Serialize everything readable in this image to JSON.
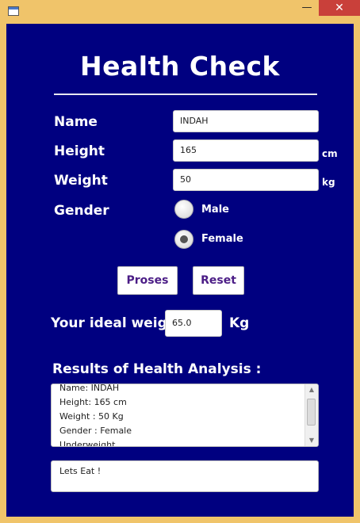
{
  "window": {
    "minimize_glyph": "—",
    "maximize_glyph": "☐",
    "close_glyph": "✕",
    "icon": "app-window-icon"
  },
  "form": {
    "title": "Health Check",
    "name_label": "Name",
    "name_value": "INDAH",
    "height_label": "Height",
    "height_value": "165",
    "height_unit": "cm",
    "weight_label": "Weight",
    "weight_value": "50",
    "weight_unit": "kg",
    "gender_label": "Gender",
    "gender_options": [
      {
        "label": "Male",
        "checked": false
      },
      {
        "label": "Female",
        "checked": true
      }
    ],
    "process_button": "Proses",
    "reset_button": "Reset",
    "ideal_weight_label": "Your ideal weight",
    "ideal_weight_value": "65.0",
    "ideal_weight_unit": "Kg"
  },
  "results": {
    "heading": "Results of Health Analysis :",
    "lines": [
      "Name: INDAH",
      "Height: 165 cm",
      "Weight : 50 Kg",
      "Gender : Female",
      "Underweight"
    ],
    "message": "Lets Eat !"
  },
  "colors": {
    "background": "#000080",
    "frame": "#f0c46a",
    "close_button": "#c9403a",
    "button_text": "#4b1d86"
  }
}
